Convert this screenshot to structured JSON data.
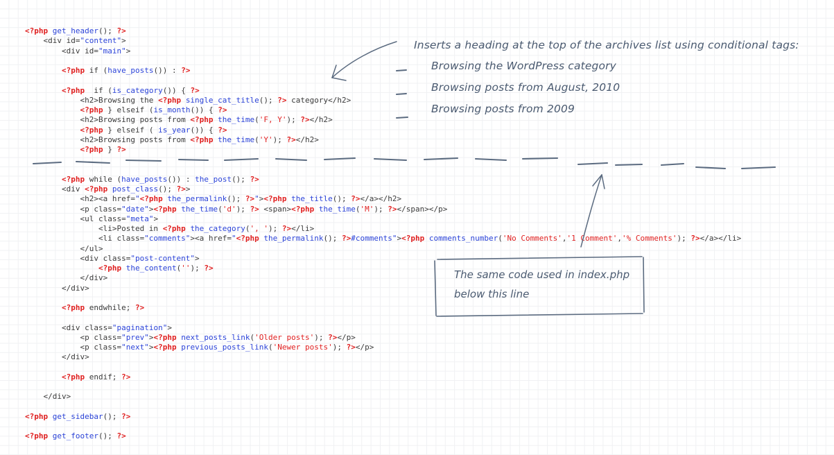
{
  "document": {
    "kind": "annotated-code-listing",
    "language": "php-html",
    "filename_referenced": "index.php"
  },
  "colors": {
    "background": "#ffffff",
    "grid_line": "#f0f1f3",
    "php_delimiter": "#e02020",
    "php_string": "#e02020",
    "function_name": "#2b43d8",
    "attribute_value": "#2b43d8",
    "plain_code": "#3a3a3a",
    "handwriting": "#4a5a70"
  },
  "code": {
    "lines": [
      [
        {
          "t": "<?php",
          "c": "php"
        },
        {
          "t": " ",
          "c": "punc"
        },
        {
          "t": "get_header",
          "c": "fn"
        },
        {
          "t": "(); ",
          "c": "punc"
        },
        {
          "t": "?>",
          "c": "php"
        }
      ],
      [
        {
          "t": "    <div id=",
          "c": "tag"
        },
        {
          "t": "\"content\"",
          "c": "attrv"
        },
        {
          "t": ">",
          "c": "tag"
        }
      ],
      [
        {
          "t": "        <div id=",
          "c": "tag"
        },
        {
          "t": "\"main\"",
          "c": "attrv"
        },
        {
          "t": ">",
          "c": "tag"
        }
      ],
      [],
      [
        {
          "t": "        ",
          "c": "punc"
        },
        {
          "t": "<?php",
          "c": "php"
        },
        {
          "t": " if (",
          "c": "punc"
        },
        {
          "t": "have_posts",
          "c": "fn"
        },
        {
          "t": "()) : ",
          "c": "punc"
        },
        {
          "t": "?>",
          "c": "php"
        }
      ],
      [],
      [
        {
          "t": "        ",
          "c": "punc"
        },
        {
          "t": "<?php",
          "c": "php"
        },
        {
          "t": "  if (",
          "c": "punc"
        },
        {
          "t": "is_category",
          "c": "fn"
        },
        {
          "t": "()) { ",
          "c": "punc"
        },
        {
          "t": "?>",
          "c": "php"
        }
      ],
      [
        {
          "t": "            <h2>Browsing the ",
          "c": "tag"
        },
        {
          "t": "<?php",
          "c": "php"
        },
        {
          "t": " ",
          "c": "punc"
        },
        {
          "t": "single_cat_title",
          "c": "fn"
        },
        {
          "t": "(); ",
          "c": "punc"
        },
        {
          "t": "?>",
          "c": "php"
        },
        {
          "t": " category</h2>",
          "c": "tag"
        }
      ],
      [
        {
          "t": "            ",
          "c": "punc"
        },
        {
          "t": "<?php",
          "c": "php"
        },
        {
          "t": " } elseif (",
          "c": "punc"
        },
        {
          "t": "is_month",
          "c": "fn"
        },
        {
          "t": "()) { ",
          "c": "punc"
        },
        {
          "t": "?>",
          "c": "php"
        }
      ],
      [
        {
          "t": "            <h2>Browsing posts from ",
          "c": "tag"
        },
        {
          "t": "<?php",
          "c": "php"
        },
        {
          "t": " ",
          "c": "punc"
        },
        {
          "t": "the_time",
          "c": "fn"
        },
        {
          "t": "(",
          "c": "punc"
        },
        {
          "t": "'F, Y'",
          "c": "str"
        },
        {
          "t": "); ",
          "c": "punc"
        },
        {
          "t": "?>",
          "c": "php"
        },
        {
          "t": "</h2>",
          "c": "tag"
        }
      ],
      [
        {
          "t": "            ",
          "c": "punc"
        },
        {
          "t": "<?php",
          "c": "php"
        },
        {
          "t": " } elseif ( ",
          "c": "punc"
        },
        {
          "t": "is_year",
          "c": "fn"
        },
        {
          "t": "()) { ",
          "c": "punc"
        },
        {
          "t": "?>",
          "c": "php"
        }
      ],
      [
        {
          "t": "            <h2>Browsing posts from ",
          "c": "tag"
        },
        {
          "t": "<?php",
          "c": "php"
        },
        {
          "t": " ",
          "c": "punc"
        },
        {
          "t": "the_time",
          "c": "fn"
        },
        {
          "t": "(",
          "c": "punc"
        },
        {
          "t": "'Y'",
          "c": "str"
        },
        {
          "t": "); ",
          "c": "punc"
        },
        {
          "t": "?>",
          "c": "php"
        },
        {
          "t": "</h2>",
          "c": "tag"
        }
      ],
      [
        {
          "t": "            ",
          "c": "punc"
        },
        {
          "t": "<?php",
          "c": "php"
        },
        {
          "t": " } ",
          "c": "punc"
        },
        {
          "t": "?>",
          "c": "php"
        }
      ],
      [],
      [],
      [
        {
          "t": "        ",
          "c": "punc"
        },
        {
          "t": "<?php",
          "c": "php"
        },
        {
          "t": " while (",
          "c": "punc"
        },
        {
          "t": "have_posts",
          "c": "fn"
        },
        {
          "t": "()) : ",
          "c": "punc"
        },
        {
          "t": "the_post",
          "c": "fn"
        },
        {
          "t": "(); ",
          "c": "punc"
        },
        {
          "t": "?>",
          "c": "php"
        }
      ],
      [
        {
          "t": "        <div ",
          "c": "tag"
        },
        {
          "t": "<?php",
          "c": "php"
        },
        {
          "t": " ",
          "c": "punc"
        },
        {
          "t": "post_class",
          "c": "fn"
        },
        {
          "t": "(); ",
          "c": "punc"
        },
        {
          "t": "?>",
          "c": "php"
        },
        {
          "t": ">",
          "c": "tag"
        }
      ],
      [
        {
          "t": "            <h2><a href=",
          "c": "tag"
        },
        {
          "t": "\"",
          "c": "attrv"
        },
        {
          "t": "<?php",
          "c": "php"
        },
        {
          "t": " ",
          "c": "punc"
        },
        {
          "t": "the_permalink",
          "c": "fn"
        },
        {
          "t": "(); ",
          "c": "punc"
        },
        {
          "t": "?>",
          "c": "php"
        },
        {
          "t": "\"",
          "c": "attrv"
        },
        {
          "t": ">",
          "c": "tag"
        },
        {
          "t": "<?php",
          "c": "php"
        },
        {
          "t": " ",
          "c": "punc"
        },
        {
          "t": "the_title",
          "c": "fn"
        },
        {
          "t": "(); ",
          "c": "punc"
        },
        {
          "t": "?>",
          "c": "php"
        },
        {
          "t": "</a></h2>",
          "c": "tag"
        }
      ],
      [
        {
          "t": "            <p class=",
          "c": "tag"
        },
        {
          "t": "\"date\"",
          "c": "attrv"
        },
        {
          "t": ">",
          "c": "tag"
        },
        {
          "t": "<?php",
          "c": "php"
        },
        {
          "t": " ",
          "c": "punc"
        },
        {
          "t": "the_time",
          "c": "fn"
        },
        {
          "t": "(",
          "c": "punc"
        },
        {
          "t": "'d'",
          "c": "str"
        },
        {
          "t": "); ",
          "c": "punc"
        },
        {
          "t": "?>",
          "c": "php"
        },
        {
          "t": " <span>",
          "c": "tag"
        },
        {
          "t": "<?php",
          "c": "php"
        },
        {
          "t": " ",
          "c": "punc"
        },
        {
          "t": "the_time",
          "c": "fn"
        },
        {
          "t": "(",
          "c": "punc"
        },
        {
          "t": "'M'",
          "c": "str"
        },
        {
          "t": "); ",
          "c": "punc"
        },
        {
          "t": "?>",
          "c": "php"
        },
        {
          "t": "</span></p>",
          "c": "tag"
        }
      ],
      [
        {
          "t": "            <ul class=",
          "c": "tag"
        },
        {
          "t": "\"meta\"",
          "c": "attrv"
        },
        {
          "t": ">",
          "c": "tag"
        }
      ],
      [
        {
          "t": "                <li>Posted in ",
          "c": "tag"
        },
        {
          "t": "<?php",
          "c": "php"
        },
        {
          "t": " ",
          "c": "punc"
        },
        {
          "t": "the_category",
          "c": "fn"
        },
        {
          "t": "(",
          "c": "punc"
        },
        {
          "t": "', '",
          "c": "str"
        },
        {
          "t": "); ",
          "c": "punc"
        },
        {
          "t": "?>",
          "c": "php"
        },
        {
          "t": "</li>",
          "c": "tag"
        }
      ],
      [
        {
          "t": "                <li class=",
          "c": "tag"
        },
        {
          "t": "\"comments\"",
          "c": "attrv"
        },
        {
          "t": "><a href=",
          "c": "tag"
        },
        {
          "t": "\"",
          "c": "attrv"
        },
        {
          "t": "<?php",
          "c": "php"
        },
        {
          "t": " ",
          "c": "punc"
        },
        {
          "t": "the_permalink",
          "c": "fn"
        },
        {
          "t": "(); ",
          "c": "punc"
        },
        {
          "t": "?>",
          "c": "php"
        },
        {
          "t": "#comments\"",
          "c": "attrv"
        },
        {
          "t": ">",
          "c": "tag"
        },
        {
          "t": "<?php",
          "c": "php"
        },
        {
          "t": " ",
          "c": "punc"
        },
        {
          "t": "comments_number",
          "c": "fn"
        },
        {
          "t": "(",
          "c": "punc"
        },
        {
          "t": "'No Comments'",
          "c": "str"
        },
        {
          "t": ",",
          "c": "punc"
        },
        {
          "t": "'1 Comment'",
          "c": "str"
        },
        {
          "t": ",",
          "c": "punc"
        },
        {
          "t": "'% Comments'",
          "c": "str"
        },
        {
          "t": "); ",
          "c": "punc"
        },
        {
          "t": "?>",
          "c": "php"
        },
        {
          "t": "</a></li>",
          "c": "tag"
        }
      ],
      [
        {
          "t": "            </ul>",
          "c": "tag"
        }
      ],
      [
        {
          "t": "            <div class=",
          "c": "tag"
        },
        {
          "t": "\"post-content\"",
          "c": "attrv"
        },
        {
          "t": ">",
          "c": "tag"
        }
      ],
      [
        {
          "t": "                ",
          "c": "punc"
        },
        {
          "t": "<?php",
          "c": "php"
        },
        {
          "t": " ",
          "c": "punc"
        },
        {
          "t": "the_content",
          "c": "fn"
        },
        {
          "t": "(",
          "c": "punc"
        },
        {
          "t": "''",
          "c": "str"
        },
        {
          "t": "); ",
          "c": "punc"
        },
        {
          "t": "?>",
          "c": "php"
        }
      ],
      [
        {
          "t": "            </div>",
          "c": "tag"
        }
      ],
      [
        {
          "t": "        </div>",
          "c": "tag"
        }
      ],
      [],
      [
        {
          "t": "        ",
          "c": "punc"
        },
        {
          "t": "<?php",
          "c": "php"
        },
        {
          "t": " endwhile; ",
          "c": "punc"
        },
        {
          "t": "?>",
          "c": "php"
        }
      ],
      [],
      [
        {
          "t": "        <div class=",
          "c": "tag"
        },
        {
          "t": "\"pagination\"",
          "c": "attrv"
        },
        {
          "t": ">",
          "c": "tag"
        }
      ],
      [
        {
          "t": "            <p class=",
          "c": "tag"
        },
        {
          "t": "\"prev\"",
          "c": "attrv"
        },
        {
          "t": ">",
          "c": "tag"
        },
        {
          "t": "<?php",
          "c": "php"
        },
        {
          "t": " ",
          "c": "punc"
        },
        {
          "t": "next_posts_link",
          "c": "fn"
        },
        {
          "t": "(",
          "c": "punc"
        },
        {
          "t": "'Older posts'",
          "c": "str"
        },
        {
          "t": "); ",
          "c": "punc"
        },
        {
          "t": "?>",
          "c": "php"
        },
        {
          "t": "</p>",
          "c": "tag"
        }
      ],
      [
        {
          "t": "            <p class=",
          "c": "tag"
        },
        {
          "t": "\"next\"",
          "c": "attrv"
        },
        {
          "t": ">",
          "c": "tag"
        },
        {
          "t": "<?php",
          "c": "php"
        },
        {
          "t": " ",
          "c": "punc"
        },
        {
          "t": "previous_posts_link",
          "c": "fn"
        },
        {
          "t": "(",
          "c": "punc"
        },
        {
          "t": "'Newer posts'",
          "c": "str"
        },
        {
          "t": "); ",
          "c": "punc"
        },
        {
          "t": "?>",
          "c": "php"
        },
        {
          "t": "</p>",
          "c": "tag"
        }
      ],
      [
        {
          "t": "        </div>",
          "c": "tag"
        }
      ],
      [],
      [
        {
          "t": "        ",
          "c": "punc"
        },
        {
          "t": "<?php",
          "c": "php"
        },
        {
          "t": " endif; ",
          "c": "punc"
        },
        {
          "t": "?>",
          "c": "php"
        }
      ],
      [],
      [
        {
          "t": "    </div>",
          "c": "tag"
        }
      ],
      [],
      [
        {
          "t": "<?php",
          "c": "php"
        },
        {
          "t": " ",
          "c": "punc"
        },
        {
          "t": "get_sidebar",
          "c": "fn"
        },
        {
          "t": "(); ",
          "c": "punc"
        },
        {
          "t": "?>",
          "c": "php"
        }
      ],
      [],
      [
        {
          "t": "<?php",
          "c": "php"
        },
        {
          "t": " ",
          "c": "punc"
        },
        {
          "t": "get_footer",
          "c": "fn"
        },
        {
          "t": "(); ",
          "c": "punc"
        },
        {
          "t": "?>",
          "c": "php"
        }
      ]
    ]
  },
  "annotations": {
    "note1": {
      "title": "Inserts a heading at the top of the archives list using conditional tags:",
      "items": [
        "Browsing the WordPress category",
        "Browsing posts from August, 2010",
        "Browsing posts from 2009"
      ]
    },
    "note2": {
      "line1": "The same code used in index.php",
      "line2": "below this line"
    }
  }
}
